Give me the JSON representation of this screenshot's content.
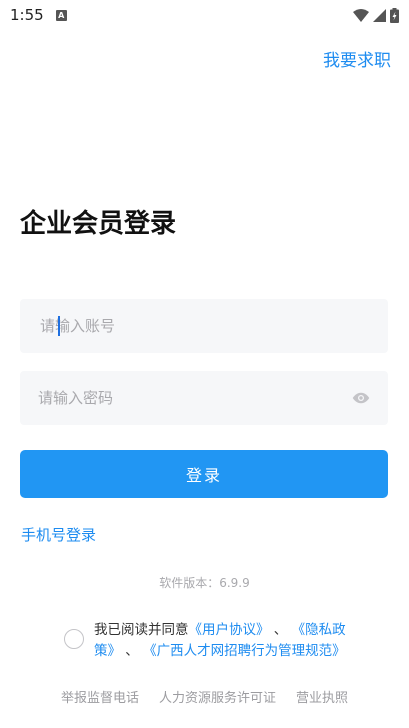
{
  "status_bar": {
    "time": "1:55",
    "notification_icon": "a-icon",
    "icons": [
      "wifi-icon",
      "signal-icon",
      "battery-charging-icon"
    ]
  },
  "header": {
    "job_seeker_link": "我要求职"
  },
  "title": "企业会员登录",
  "form": {
    "account_placeholder": "请输入账号",
    "password_placeholder": "请输入密码",
    "login_button": "登录",
    "phone_login": "手机号登录"
  },
  "version": "软件版本：6.9.9",
  "agreement": {
    "prefix": "我已阅读并同意",
    "user_agreement": "《用户协议》",
    "sep1": " 、",
    "privacy_policy": "《隐私政策》",
    "sep2": " 、",
    "recruitment_rules": "《广西人才网招聘行为管理规范》"
  },
  "footer": {
    "report_phone": "举报监督电话",
    "hr_license": "人力资源服务许可证",
    "business_license": "营业执照"
  },
  "colors": {
    "accent": "#2196f3",
    "link": "#1e8cf0",
    "input_bg": "#f6f7f9"
  }
}
